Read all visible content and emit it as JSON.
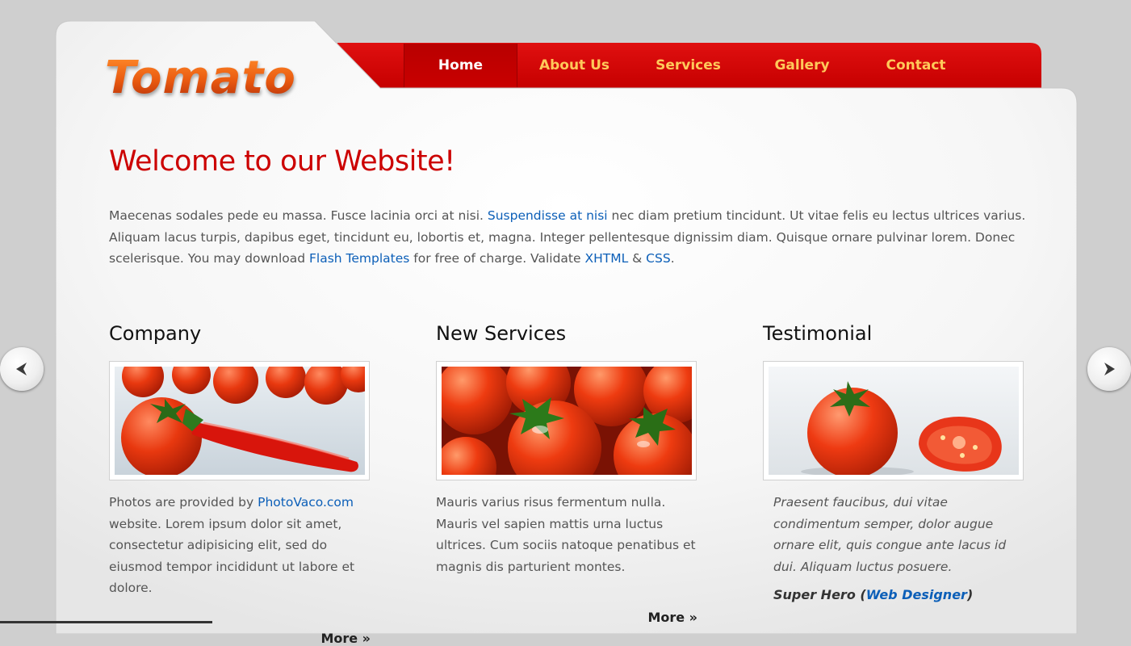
{
  "brand": {
    "logo_text": "Tomato"
  },
  "nav": {
    "items": [
      {
        "label": "Home",
        "active": true
      },
      {
        "label": "About Us",
        "active": false
      },
      {
        "label": "Services",
        "active": false
      },
      {
        "label": "Gallery",
        "active": false
      },
      {
        "label": "Contact",
        "active": false
      }
    ]
  },
  "colors": {
    "accent_red": "#cc0000",
    "nav_text": "#ffc95a",
    "link_blue": "#0c5fb8",
    "logo_orange": "#e95a10"
  },
  "welcome": {
    "title": "Welcome to our Website!",
    "text_1": "Maecenas sodales pede eu massa. Fusce lacinia orci at nisi. ",
    "link_1": "Suspendisse at nisi",
    "text_2": " nec diam pretium tincidunt. Ut vitae felis eu lectus ultrices varius. Aliquam lacus turpis, dapibus eget, tincidunt eu, lobortis et, magna. Integer pellentesque dignissim diam. Quisque ornare pulvinar lorem. Donec scelerisque. You may download ",
    "link_2": "Flash Templates",
    "text_3": " for free of charge. Validate ",
    "link_3": "XHTML",
    "text_4": " & ",
    "link_4": "CSS",
    "text_5": "."
  },
  "columns": {
    "company": {
      "heading": "Company",
      "text_1": "Photos are provided by ",
      "link": "PhotoVaco.com",
      "text_2": " website. Lorem ipsum dolor sit amet, consectetur adipisicing elit, sed do eiusmod tempor incididunt ut labore et dolore.",
      "more": "More »"
    },
    "services": {
      "heading": "New Services",
      "text": "Mauris varius risus fermentum nulla. Mauris vel sapien mattis urna luctus ultrices. Cum sociis natoque penatibus et magnis dis parturient montes.",
      "more": "More »"
    },
    "testimonial": {
      "heading": "Testimonial",
      "quote": "Praesent faucibus, dui vitae condimentum semper, dolor augue ornare elit, quis congue ante lacus id dui. Aliquam luctus posuere.",
      "author_name": "Super Hero",
      "author_open": " (",
      "author_role": "Web Designer",
      "author_close": ")"
    }
  },
  "icons": {
    "prev": "arrow-left-icon",
    "next": "arrow-right-icon"
  }
}
